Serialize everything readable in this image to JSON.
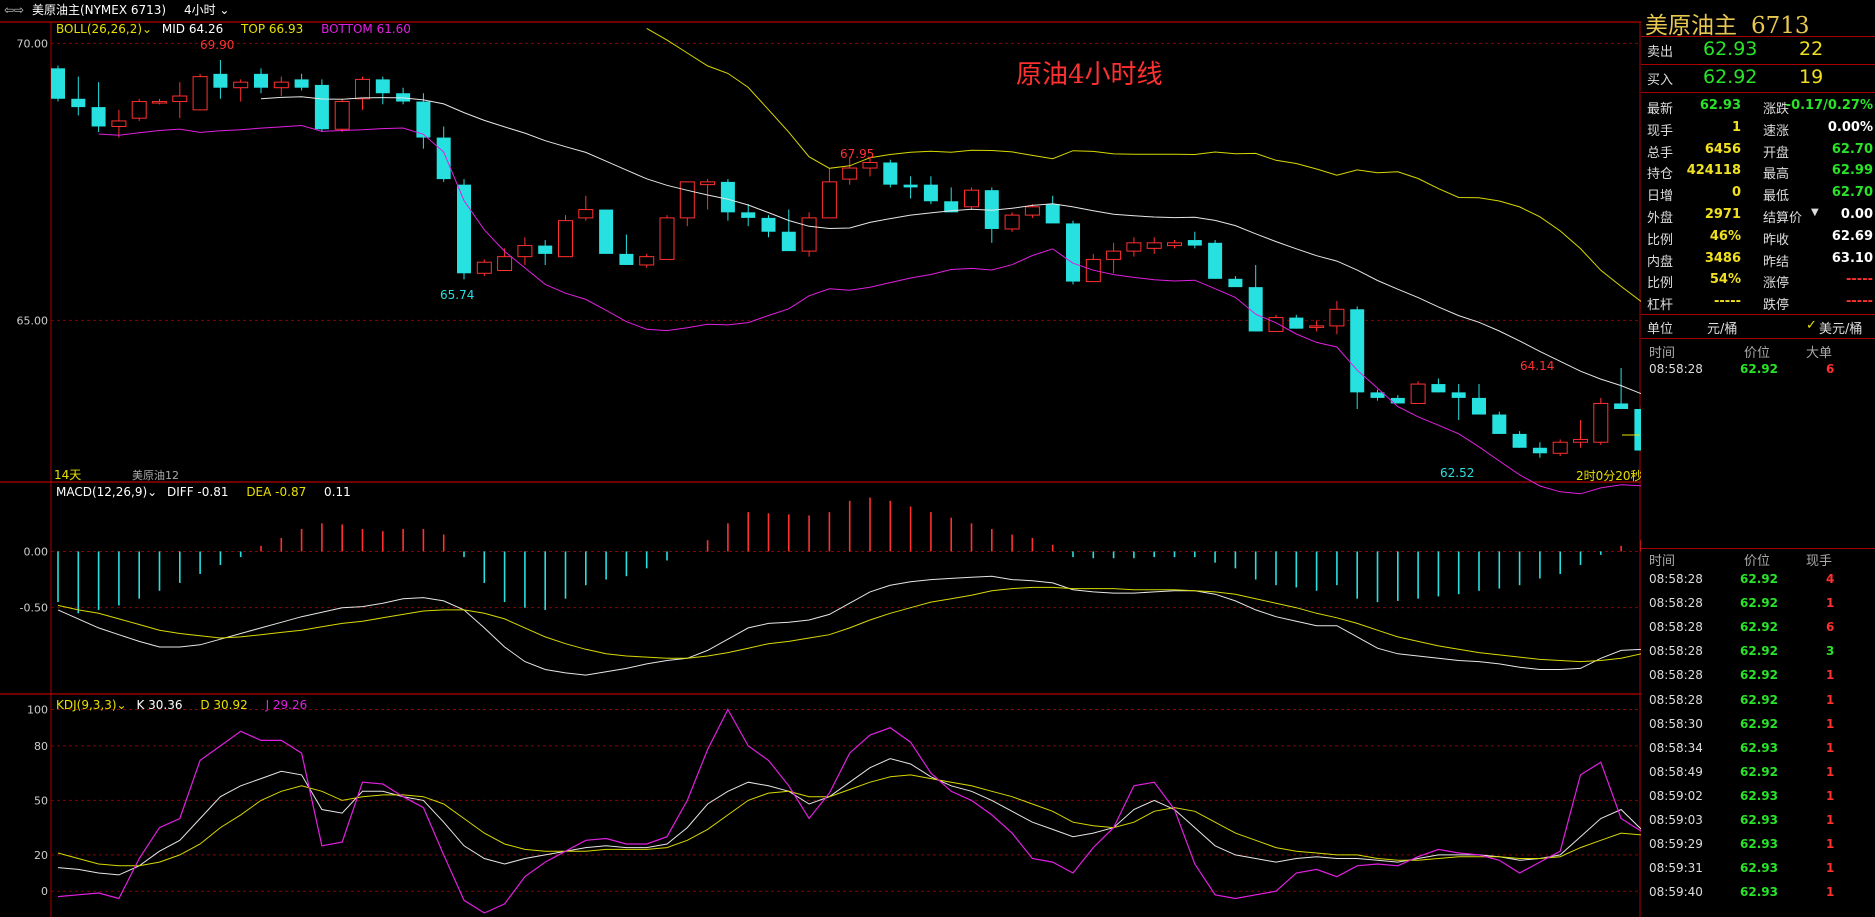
{
  "header": {
    "symbol_label": "美原油主(NYMEX 6713)",
    "period": "4小时",
    "window_icon": "window-icon",
    "dropdown_icon": "chevron-down-icon"
  },
  "chart_title": "原油4小时线",
  "boll": {
    "label": "BOLL(26,26,2)",
    "mid": "MID 64.26",
    "top": "TOP 66.93",
    "bottom": "BOTTOM 61.60"
  },
  "macd": {
    "label": "MACD(12,26,9)",
    "diff": "DIFF -0.81",
    "dea": "DEA -0.87",
    "macd": "0.11"
  },
  "kdj": {
    "label": "KDJ(9,3,3)",
    "k": "K 30.36",
    "d": "D 30.92",
    "j": "J 29.26"
  },
  "main_annotations": {
    "hi1": "69.90",
    "lo1": "65.74",
    "hi2": "67.95",
    "hi3": "64.14",
    "lo2": "62.52",
    "days": "14天",
    "contract": "美原油12",
    "countdown": "2时0分20秒"
  },
  "colors": {
    "up": "#ff3030",
    "down": "#27e0e0",
    "boll_mid": "#e6e6e6",
    "boll_top": "#d8d800",
    "boll_bottom": "#e020e0",
    "grid": "#8b0000"
  },
  "chart_data": {
    "type": "candlestick",
    "price_axis_ticks": [
      "70.00",
      "65.00"
    ],
    "macd_axis_ticks": [
      "0.00",
      "-0.50"
    ],
    "kdj_axis_ticks": [
      "100",
      "80",
      "50",
      "20",
      "0"
    ],
    "candles_ohlc": [
      [
        69.55,
        69.6,
        68.95,
        69.0
      ],
      [
        69.0,
        69.4,
        68.7,
        68.85
      ],
      [
        68.85,
        69.3,
        68.4,
        68.5
      ],
      [
        68.5,
        68.8,
        68.3,
        68.6
      ],
      [
        68.65,
        69.0,
        68.6,
        68.95
      ],
      [
        68.95,
        69.0,
        68.9,
        68.95
      ],
      [
        68.95,
        69.3,
        68.65,
        69.05
      ],
      [
        68.8,
        69.45,
        68.8,
        69.4
      ],
      [
        69.45,
        69.7,
        69.0,
        69.2
      ],
      [
        69.2,
        69.35,
        68.95,
        69.3
      ],
      [
        69.45,
        69.55,
        69.1,
        69.2
      ],
      [
        69.2,
        69.4,
        69.05,
        69.3
      ],
      [
        69.35,
        69.45,
        69.15,
        69.2
      ],
      [
        69.25,
        69.35,
        68.4,
        68.45
      ],
      [
        68.45,
        69.0,
        68.4,
        68.95
      ],
      [
        69.0,
        69.4,
        68.8,
        69.35
      ],
      [
        69.35,
        69.4,
        68.9,
        69.1
      ],
      [
        69.1,
        69.2,
        68.9,
        68.95
      ],
      [
        68.95,
        69.1,
        68.1,
        68.3
      ],
      [
        68.3,
        68.5,
        67.5,
        67.55
      ],
      [
        67.45,
        67.55,
        65.74,
        65.85
      ],
      [
        65.85,
        66.1,
        65.8,
        66.05
      ],
      [
        65.9,
        66.3,
        65.9,
        66.15
      ],
      [
        66.15,
        66.5,
        66.0,
        66.35
      ],
      [
        66.35,
        66.45,
        66.0,
        66.2
      ],
      [
        66.15,
        66.9,
        66.15,
        66.8
      ],
      [
        66.85,
        67.25,
        66.8,
        67.0
      ],
      [
        67.0,
        67.0,
        66.3,
        66.2
      ],
      [
        66.2,
        66.55,
        66.0,
        66.0
      ],
      [
        66.0,
        66.2,
        65.95,
        66.15
      ],
      [
        66.1,
        66.9,
        66.1,
        66.85
      ],
      [
        66.85,
        67.5,
        66.7,
        67.5
      ],
      [
        67.45,
        67.55,
        67.0,
        67.5
      ],
      [
        67.5,
        67.55,
        66.8,
        66.95
      ],
      [
        66.95,
        67.1,
        66.7,
        66.85
      ],
      [
        66.85,
        66.9,
        66.5,
        66.6
      ],
      [
        66.6,
        67.0,
        66.3,
        66.25
      ],
      [
        66.25,
        66.95,
        66.15,
        66.85
      ],
      [
        66.85,
        67.75,
        66.85,
        67.5
      ],
      [
        67.55,
        67.95,
        67.45,
        67.75
      ],
      [
        67.75,
        67.95,
        67.6,
        67.85
      ],
      [
        67.85,
        67.9,
        67.4,
        67.45
      ],
      [
        67.45,
        67.6,
        67.2,
        67.4
      ],
      [
        67.45,
        67.6,
        67.1,
        67.15
      ],
      [
        67.15,
        67.4,
        66.95,
        66.95
      ],
      [
        67.05,
        67.4,
        67.0,
        67.35
      ],
      [
        67.35,
        67.4,
        66.4,
        66.65
      ],
      [
        66.65,
        66.95,
        66.6,
        66.9
      ],
      [
        66.9,
        67.1,
        66.85,
        67.05
      ],
      [
        67.1,
        67.25,
        66.75,
        66.75
      ],
      [
        66.75,
        66.8,
        65.65,
        65.7
      ],
      [
        65.7,
        66.2,
        65.7,
        66.1
      ],
      [
        66.1,
        66.4,
        65.85,
        66.25
      ],
      [
        66.25,
        66.5,
        66.15,
        66.4
      ],
      [
        66.3,
        66.5,
        66.2,
        66.4
      ],
      [
        66.35,
        66.45,
        66.3,
        66.4
      ],
      [
        66.45,
        66.6,
        66.3,
        66.35
      ],
      [
        66.4,
        66.45,
        65.75,
        65.75
      ],
      [
        65.75,
        65.8,
        65.7,
        65.6
      ],
      [
        65.6,
        66.0,
        64.8,
        64.8
      ],
      [
        64.8,
        65.1,
        64.8,
        65.05
      ],
      [
        65.05,
        65.1,
        64.85,
        64.85
      ],
      [
        64.9,
        65.0,
        64.8,
        64.9
      ],
      [
        64.9,
        65.35,
        64.75,
        65.2
      ],
      [
        65.2,
        65.25,
        63.4,
        63.7
      ],
      [
        63.7,
        63.75,
        63.55,
        63.6
      ],
      [
        63.6,
        63.65,
        63.5,
        63.5
      ],
      [
        63.5,
        63.9,
        63.5,
        63.85
      ],
      [
        63.85,
        63.95,
        63.7,
        63.7
      ],
      [
        63.7,
        63.85,
        63.2,
        63.6
      ],
      [
        63.6,
        63.85,
        63.3,
        63.3
      ],
      [
        63.3,
        63.35,
        62.95,
        62.95
      ],
      [
        62.95,
        63.0,
        62.7,
        62.7
      ],
      [
        62.7,
        62.8,
        62.52,
        62.6
      ],
      [
        62.6,
        62.85,
        62.55,
        62.8
      ],
      [
        62.8,
        63.2,
        62.7,
        62.85
      ],
      [
        62.8,
        63.6,
        62.75,
        63.5
      ],
      [
        63.5,
        64.14,
        63.4,
        63.4
      ],
      [
        63.4,
        63.45,
        62.65,
        62.65
      ],
      [
        62.7,
        62.95,
        62.55,
        62.93
      ]
    ],
    "boll_top": [
      null,
      null,
      null,
      null,
      null,
      null,
      null,
      null,
      null,
      null,
      null,
      null,
      null,
      null,
      null,
      null,
      null,
      null,
      null,
      null,
      null,
      null,
      null,
      null,
      null,
      null,
      null,
      null,
      null,
      null,
      null,
      null,
      null,
      null,
      null,
      null,
      null,
      null,
      null,
      null,
      null,
      null,
      null,
      null,
      null,
      null,
      null,
      null,
      null,
      null,
      null,
      null,
      null,
      null,
      null,
      null,
      null,
      null,
      null,
      null,
      null,
      null,
      null,
      null,
      null,
      null,
      null,
      null,
      null,
      null,
      null,
      null,
      null,
      null,
      null,
      null,
      null,
      null,
      null,
      null
    ],
    "macd_hist": [
      -0.45,
      -0.55,
      -0.52,
      -0.48,
      -0.42,
      -0.35,
      -0.28,
      -0.2,
      -0.12,
      -0.05,
      0.05,
      0.12,
      0.2,
      0.25,
      0.24,
      0.2,
      0.18,
      0.2,
      0.2,
      0.15,
      -0.05,
      -0.28,
      -0.45,
      -0.5,
      -0.52,
      -0.42,
      -0.3,
      -0.25,
      -0.22,
      -0.15,
      -0.08,
      0.0,
      0.1,
      0.25,
      0.35,
      0.34,
      0.33,
      0.32,
      0.35,
      0.45,
      0.48,
      0.45,
      0.4,
      0.35,
      0.3,
      0.25,
      0.2,
      0.15,
      0.12,
      0.06,
      -0.05,
      -0.06,
      -0.06,
      -0.06,
      -0.05,
      -0.05,
      -0.05,
      -0.1,
      -0.15,
      -0.25,
      -0.3,
      -0.32,
      -0.35,
      -0.3,
      -0.42,
      -0.45,
      -0.44,
      -0.42,
      -0.4,
      -0.38,
      -0.35,
      -0.33,
      -0.3,
      -0.24,
      -0.2,
      -0.12,
      -0.03,
      0.05,
      0.1,
      0.11
    ],
    "macd_diff": [
      -0.52,
      -0.6,
      -0.68,
      -0.74,
      -0.8,
      -0.85,
      -0.85,
      -0.83,
      -0.78,
      -0.73,
      -0.68,
      -0.63,
      -0.58,
      -0.54,
      -0.5,
      -0.49,
      -0.46,
      -0.42,
      -0.41,
      -0.44,
      -0.52,
      -0.68,
      -0.85,
      -0.98,
      -1.05,
      -1.08,
      -1.1,
      -1.07,
      -1.04,
      -1.0,
      -0.97,
      -0.95,
      -0.88,
      -0.78,
      -0.68,
      -0.64,
      -0.63,
      -0.61,
      -0.56,
      -0.46,
      -0.36,
      -0.3,
      -0.27,
      -0.25,
      -0.24,
      -0.23,
      -0.22,
      -0.25,
      -0.26,
      -0.28,
      -0.34,
      -0.36,
      -0.37,
      -0.37,
      -0.36,
      -0.35,
      -0.35,
      -0.38,
      -0.44,
      -0.52,
      -0.58,
      -0.62,
      -0.66,
      -0.66,
      -0.76,
      -0.86,
      -0.91,
      -0.93,
      -0.95,
      -0.97,
      -0.98,
      -1.0,
      -1.03,
      -1.05,
      -1.05,
      -1.04,
      -0.95,
      -0.88,
      -0.87,
      -0.81
    ],
    "macd_dea": [
      -0.48,
      -0.52,
      -0.55,
      -0.6,
      -0.65,
      -0.7,
      -0.73,
      -0.75,
      -0.77,
      -0.76,
      -0.74,
      -0.72,
      -0.7,
      -0.67,
      -0.64,
      -0.62,
      -0.59,
      -0.56,
      -0.53,
      -0.52,
      -0.52,
      -0.55,
      -0.6,
      -0.68,
      -0.76,
      -0.82,
      -0.87,
      -0.91,
      -0.93,
      -0.94,
      -0.95,
      -0.95,
      -0.93,
      -0.9,
      -0.86,
      -0.82,
      -0.8,
      -0.77,
      -0.74,
      -0.68,
      -0.61,
      -0.55,
      -0.5,
      -0.45,
      -0.42,
      -0.39,
      -0.35,
      -0.33,
      -0.32,
      -0.32,
      -0.33,
      -0.33,
      -0.33,
      -0.34,
      -0.34,
      -0.34,
      -0.35,
      -0.36,
      -0.38,
      -0.42,
      -0.46,
      -0.5,
      -0.55,
      -0.59,
      -0.64,
      -0.7,
      -0.76,
      -0.8,
      -0.84,
      -0.87,
      -0.9,
      -0.92,
      -0.94,
      -0.96,
      -0.97,
      -0.98,
      -0.97,
      -0.95,
      -0.91,
      -0.87
    ],
    "kdj_k": [
      13,
      12,
      10,
      9,
      14,
      22,
      28,
      40,
      52,
      58,
      62,
      66,
      64,
      45,
      43,
      55,
      55,
      52,
      50,
      38,
      25,
      18,
      15,
      18,
      20,
      22,
      24,
      25,
      24,
      24,
      26,
      35,
      48,
      55,
      60,
      58,
      55,
      48,
      52,
      60,
      68,
      73,
      70,
      63,
      58,
      55,
      50,
      44,
      38,
      34,
      30,
      32,
      35,
      45,
      50,
      45,
      35,
      25,
      20,
      18,
      16,
      18,
      19,
      18,
      18,
      17,
      16,
      18,
      20,
      20,
      20,
      19,
      17,
      18,
      20,
      30,
      40,
      45,
      34,
      30
    ],
    "kdj_d": [
      21,
      18,
      15,
      14,
      14,
      16,
      20,
      26,
      35,
      42,
      50,
      55,
      58,
      55,
      50,
      52,
      53,
      53,
      52,
      48,
      40,
      32,
      26,
      23,
      22,
      22,
      22,
      23,
      23,
      23,
      24,
      28,
      34,
      42,
      50,
      54,
      55,
      52,
      52,
      56,
      60,
      63,
      64,
      62,
      60,
      58,
      55,
      52,
      48,
      44,
      38,
      36,
      35,
      38,
      44,
      46,
      44,
      38,
      32,
      28,
      24,
      22,
      21,
      20,
      20,
      18,
      17,
      17,
      18,
      19,
      19,
      19,
      18,
      18,
      19,
      24,
      28,
      32,
      31,
      30
    ],
    "kdj_j": [
      -3,
      -2,
      -1,
      -4,
      18,
      35,
      40,
      72,
      80,
      88,
      83,
      83,
      76,
      25,
      27,
      60,
      59,
      52,
      46,
      20,
      -5,
      -12,
      -7,
      8,
      16,
      22,
      28,
      29,
      26,
      26,
      30,
      50,
      78,
      100,
      80,
      72,
      58,
      40,
      54,
      76,
      86,
      90,
      82,
      65,
      55,
      50,
      42,
      32,
      18,
      16,
      10,
      24,
      35,
      58,
      60,
      45,
      15,
      -2,
      -4,
      -2,
      0,
      10,
      12,
      8,
      14,
      15,
      14,
      19,
      23,
      21,
      20,
      17,
      10,
      16,
      22,
      64,
      71,
      40,
      33,
      29
    ]
  },
  "quote": {
    "name": "美原油主",
    "code": "6713",
    "sell_label": "卖出",
    "sell_price": "62.93",
    "sell_qty": "22",
    "buy_label": "买入",
    "buy_price": "62.92",
    "buy_qty": "19",
    "stats_left": [
      {
        "label": "最新",
        "value": "62.93"
      },
      {
        "label": "现手",
        "value": "1"
      },
      {
        "label": "总手",
        "value": "6456"
      },
      {
        "label": "持仓",
        "value": "424118"
      },
      {
        "label": "日增",
        "value": "0"
      },
      {
        "label": "外盘",
        "value": "2971"
      },
      {
        "label": "比例",
        "value": "46%"
      },
      {
        "label": "内盘",
        "value": "3486"
      },
      {
        "label": "比例",
        "value": "54%"
      },
      {
        "label": "杠杆",
        "value": "-----"
      }
    ],
    "stats_right": [
      {
        "label": "涨跌",
        "value": "-0.17/0.27%"
      },
      {
        "label": "速涨",
        "value": "0.00%"
      },
      {
        "label": "开盘",
        "value": "62.70"
      },
      {
        "label": "最高",
        "value": "62.99"
      },
      {
        "label": "最低",
        "value": "62.70"
      },
      {
        "label": "结算价",
        "value": "0.00"
      },
      {
        "label": "昨收",
        "value": "62.69"
      },
      {
        "label": "昨结",
        "value": "63.10"
      },
      {
        "label": "涨停",
        "value": "-----"
      },
      {
        "label": "跌停",
        "value": "-----"
      }
    ],
    "unit_label": "单位",
    "unit_value": "元/桶",
    "unit_check": "美元/桶",
    "big_header": {
      "time": "时间",
      "price": "价位",
      "size": "大单"
    },
    "big_orders": [
      {
        "time": "08:58:28",
        "price": "62.92",
        "size": "6"
      }
    ],
    "tick_header": {
      "time": "时间",
      "price": "价位",
      "size": "现手"
    },
    "ticks": [
      {
        "time": "08:58:28",
        "price": "62.92",
        "size": "4"
      },
      {
        "time": "08:58:28",
        "price": "62.92",
        "size": "1"
      },
      {
        "time": "08:58:28",
        "price": "62.92",
        "size": "6"
      },
      {
        "time": "08:58:28",
        "price": "62.92",
        "size": "3"
      },
      {
        "time": "08:58:28",
        "price": "62.92",
        "size": "1"
      },
      {
        "time": "08:58:28",
        "price": "62.92",
        "size": "1"
      },
      {
        "time": "08:58:30",
        "price": "62.92",
        "size": "1"
      },
      {
        "time": "08:58:34",
        "price": "62.93",
        "size": "1"
      },
      {
        "time": "08:58:49",
        "price": "62.92",
        "size": "1"
      },
      {
        "time": "08:59:02",
        "price": "62.93",
        "size": "1"
      },
      {
        "time": "08:59:03",
        "price": "62.93",
        "size": "1"
      },
      {
        "time": "08:59:29",
        "price": "62.93",
        "size": "1"
      },
      {
        "time": "08:59:31",
        "price": "62.93",
        "size": "1"
      },
      {
        "time": "08:59:40",
        "price": "62.93",
        "size": "1"
      }
    ]
  }
}
